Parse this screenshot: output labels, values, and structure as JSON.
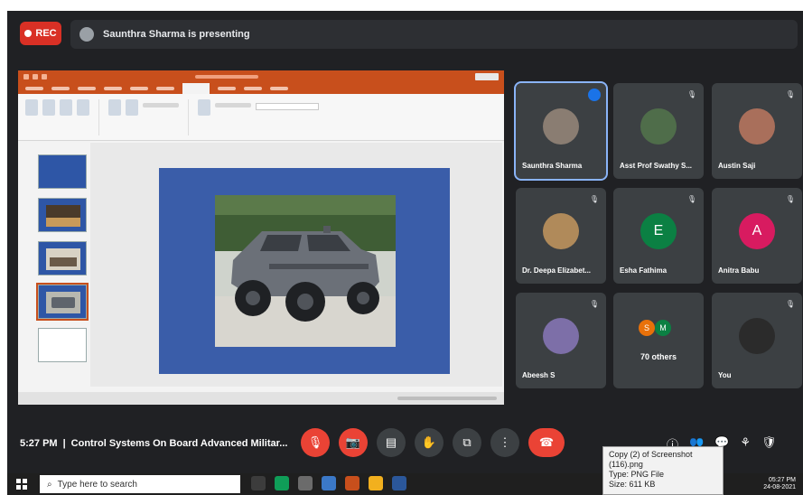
{
  "meeting": {
    "rec_label": "REC",
    "presenting_text": "Saunthra Sharma is presenting",
    "time": "5:27 PM",
    "title": "Control Systems On Board Advanced Militar..."
  },
  "participants": [
    {
      "name": "Saunthra Sharma",
      "avatar": "photo",
      "speaking": true
    },
    {
      "name": "Asst Prof Swathy S...",
      "avatar": "photo"
    },
    {
      "name": "Austin Saji",
      "avatar": "photo"
    },
    {
      "name": "Dr. Deepa Elizabet...",
      "avatar": "photo"
    },
    {
      "name": "Esha Fathima",
      "avatar_letter": "E",
      "color": "#0b8043"
    },
    {
      "name": "Anitra Babu",
      "avatar_letter": "A",
      "color": "#d81b60"
    },
    {
      "name": "Abeesh S",
      "avatar": "photo"
    },
    {
      "name": "70 others",
      "others_letters": [
        "S",
        "M"
      ],
      "colors": [
        "#e8710a",
        "#0b8043"
      ]
    },
    {
      "name": "You",
      "avatar": "photo"
    }
  ],
  "controls": [
    "mic-off",
    "camera-off",
    "captions",
    "raise-hand",
    "present",
    "more",
    "end-call"
  ],
  "colors": {
    "meet_bg": "#202124",
    "tile_bg": "#3c4043",
    "accent_red": "#ea4335",
    "ppt_orange": "#c84f1c",
    "slide_blue": "#3a5da9"
  },
  "taskbar": {
    "search_placeholder": "Type here to search",
    "clock_time": "05:27 PM",
    "clock_date": "24-08-2021"
  },
  "tooltip": {
    "line1": "Copy (2) of Screenshot",
    "line2": "(116).png",
    "line3": "Type: PNG File",
    "line4": "Size: 611 KB"
  }
}
